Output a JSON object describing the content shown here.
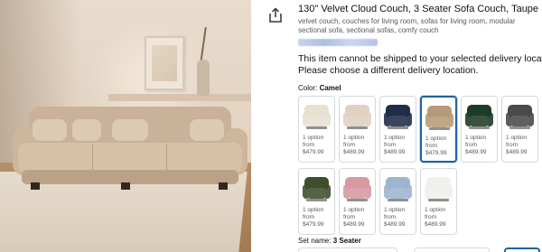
{
  "product": {
    "title": "130\" Velvet Cloud Couch, 3 Seater Sofa Couch, Taupe",
    "keywords": "velvet couch, couches for living room, sofas for living room, modular sectional sofa, sectional sofas, comfy couch"
  },
  "delivery": {
    "line1": "This item cannot be shipped to your selected delivery location.",
    "line2": "Please choose a different delivery location."
  },
  "color": {
    "label": "Color:",
    "selected": "Camel",
    "options": [
      {
        "name": "cream",
        "option_text": "1 option",
        "from": "from",
        "price": "$479.99",
        "color": "#e8e0d2"
      },
      {
        "name": "beige",
        "option_text": "1 option",
        "from": "from",
        "price": "$489.99",
        "color": "#dfd2c0"
      },
      {
        "name": "navy",
        "option_text": "1 option",
        "from": "from",
        "price": "$489.99",
        "color": "#1f2d4a"
      },
      {
        "name": "camel",
        "option_text": "1 option",
        "from": "from",
        "price": "$479.99",
        "color": "#b79a79"
      },
      {
        "name": "green",
        "option_text": "1 option",
        "from": "from",
        "price": "$489.99",
        "color": "#1f3b26"
      },
      {
        "name": "gray",
        "option_text": "1 option",
        "from": "from",
        "price": "$489.99",
        "color": "#4a4a4a"
      },
      {
        "name": "olive",
        "option_text": "1 option",
        "from": "from",
        "price": "$479.99",
        "color": "#3f4e2b"
      },
      {
        "name": "pink",
        "option_text": "1 option",
        "from": "from",
        "price": "$489.99",
        "color": "#d79aa0"
      },
      {
        "name": "blue",
        "option_text": "1 option",
        "from": "from",
        "price": "$489.99",
        "color": "#9db5cf"
      },
      {
        "name": "white",
        "option_text": "1 option",
        "from": "from",
        "price": "$489.99",
        "color": "#f2f0ec"
      }
    ]
  },
  "set": {
    "label": "Set name:",
    "selected": "3 Seater"
  },
  "colors": {
    "accent": "#2162a1",
    "text": "#0f1111",
    "muted": "#565959",
    "border": "#d5d9d9"
  },
  "icons": {
    "share": "share-icon"
  }
}
